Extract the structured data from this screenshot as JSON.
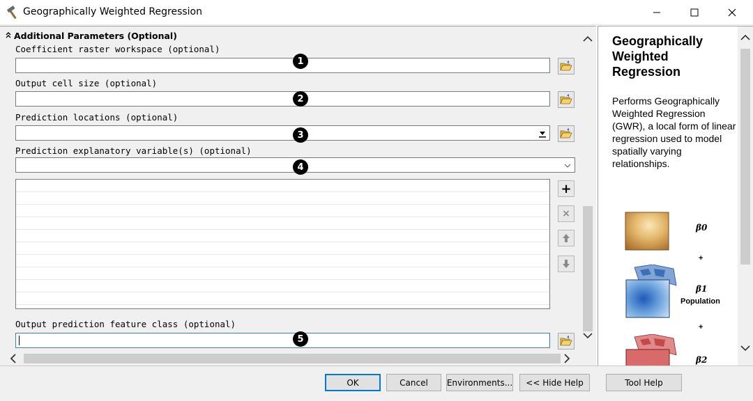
{
  "window": {
    "title": "Geographically Weighted Regression"
  },
  "section": {
    "label": "Additional Parameters (Optional)"
  },
  "params": [
    {
      "label": "Coefficient raster workspace (optional)",
      "value": "",
      "badge": "1"
    },
    {
      "label": "Output cell size (optional)",
      "value": "",
      "badge": "2"
    },
    {
      "label": "Prediction locations (optional)",
      "value": "",
      "badge": "3"
    },
    {
      "label": "Prediction explanatory variable(s) (optional)",
      "value": "",
      "badge": "4"
    },
    {
      "label": "Output prediction feature class (optional)",
      "value": "",
      "badge": "5"
    }
  ],
  "list_buttons": {
    "add": "+",
    "remove": "×"
  },
  "help": {
    "title": "Geographically Weighted Regression",
    "description": "Performs Geographically Weighted Regression (GWR), a local form of linear regression used to model spatially varying relationships.",
    "beta0": "β0",
    "beta1": "β1",
    "beta1_note": "Population",
    "beta2": "β2",
    "plus": "+"
  },
  "buttons": {
    "ok": "OK",
    "cancel": "Cancel",
    "environments": "Environments...",
    "hide_help": "<< Hide Help",
    "tool_help": "Tool Help"
  },
  "colors": {
    "focus_border": "#3c7fb1",
    "default_button_border": "#0078d7"
  },
  "icons": {
    "app": "hammer-icon",
    "browse": "folder-open-icon",
    "add": "plus-icon",
    "remove": "x-icon",
    "up": "arrow-up-icon",
    "down": "arrow-down-icon"
  }
}
